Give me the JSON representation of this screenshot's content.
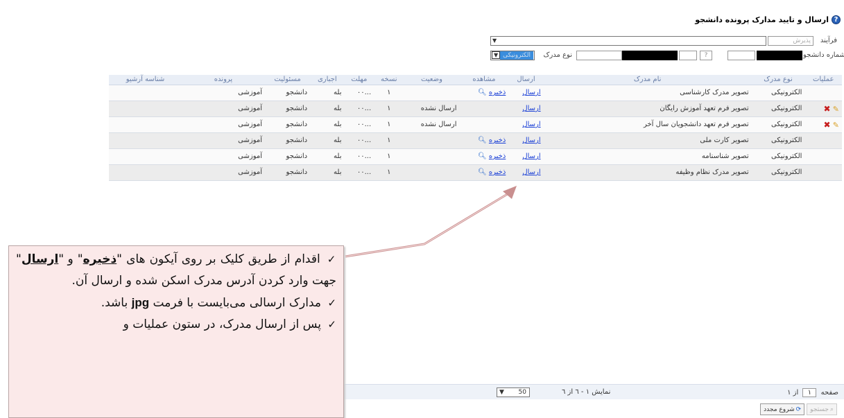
{
  "page": {
    "title": "ارسال و تایید مدارک پرونده دانشجو"
  },
  "filters": {
    "process_label": "فرآیند",
    "process_value": "پذیرش",
    "student_label": "شماره دانشجو",
    "doc_type_label": "نوع مدرک",
    "doc_type_value": "الکترونیکی"
  },
  "table": {
    "headers": [
      "عملیات",
      "نوع مدرک",
      "نام مدرک",
      "ارسال",
      "مشاهده",
      "وضعیت",
      "نسخه",
      "مهلت",
      "اجباری",
      "مسئولیت",
      "پرونده",
      "شناسه آرشیو"
    ],
    "rows": [
      {
        "type": "الکترونیکی",
        "name": "تصویر مدرک کارشناسی",
        "send": "ارسال",
        "save": "ذخیره",
        "status": "",
        "copy": "۱",
        "deadline": "...۰۰",
        "mandatory": "بله",
        "resp": "دانشجو",
        "file": "آموزشی",
        "edit": false
      },
      {
        "type": "الکترونیکی",
        "name": "تصویر فرم تعهد آموزش رایگان",
        "send": "ارسال",
        "save": "",
        "status": "ارسال نشده",
        "copy": "۱",
        "deadline": "...۰۰",
        "mandatory": "بله",
        "resp": "دانشجو",
        "file": "آموزشی",
        "edit": true
      },
      {
        "type": "الکترونیکی",
        "name": "تصویر فرم تعهد دانشجویان سال آخر",
        "send": "ارسال",
        "save": "",
        "status": "ارسال نشده",
        "copy": "۱",
        "deadline": "...۰۰",
        "mandatory": "بله",
        "resp": "دانشجو",
        "file": "آموزشی",
        "edit": true
      },
      {
        "type": "الکترونیکی",
        "name": "تصویر کارت ملی",
        "send": "ارسال",
        "save": "ذخیره",
        "status": "",
        "copy": "۱",
        "deadline": "...۰۰",
        "mandatory": "بله",
        "resp": "دانشجو",
        "file": "آموزشی",
        "edit": false
      },
      {
        "type": "الکترونیکی",
        "name": "تصویر شناسنامه",
        "send": "ارسال",
        "save": "ذخیره",
        "status": "",
        "copy": "۱",
        "deadline": "...۰۰",
        "mandatory": "بله",
        "resp": "دانشجو",
        "file": "آموزشی",
        "edit": false
      },
      {
        "type": "الکترونیکی",
        "name": "تصویر مدرک نظام وظیفه",
        "send": "ارسال",
        "save": "ذخیره",
        "status": "",
        "copy": "۱",
        "deadline": "...۰۰",
        "mandatory": "بله",
        "resp": "دانشجو",
        "file": "آموزشی",
        "edit": false
      }
    ]
  },
  "footer": {
    "page_label": "صفحه",
    "page_value": "۱",
    "page_of": "از ۱",
    "page_size": "50",
    "showing": "نمایش ۱ - ٦ از ٦"
  },
  "buttons": {
    "refresh": "شروع مجدد",
    "search": "جستجو"
  },
  "callout": {
    "line1_a": "اقدام از طریق کلیک بر روی آیکون های",
    "save_word": "ذخیره",
    "and": "و",
    "send_word": "ارسال",
    "line1_b": "جهت وارد کردن آدرس مدرک اسکن شده و ارسال آن.",
    "line2_a": "مدارک ارسالی می‌بایست با فرمت",
    "format": "jpg",
    "line2_b": "باشد.",
    "line3": "پس از ارسال مدرک، در ستون عملیات و"
  }
}
